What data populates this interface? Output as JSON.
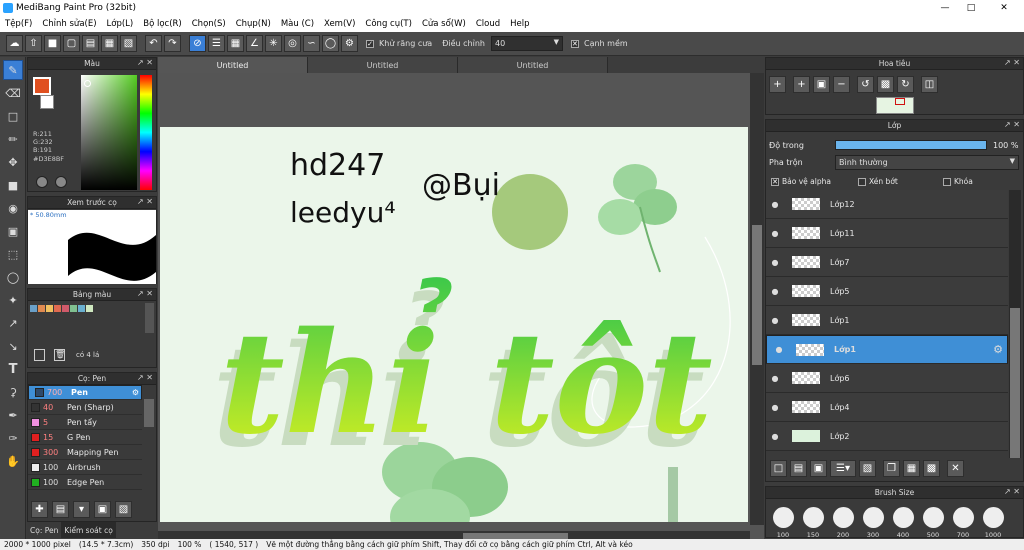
{
  "app": {
    "title": "MediBang Paint Pro (32bit)"
  },
  "menu": [
    "Tệp(F)",
    "Chỉnh sửa(E)",
    "Lớp(L)",
    "Bộ lọc(R)",
    "Chọn(S)",
    "Chụp(N)",
    "Màu (C)",
    "Xem(V)",
    "Công cụ(T)",
    "Cửa sổ(W)",
    "Cloud",
    "Help"
  ],
  "toolbar": {
    "antialias_label": "Khử răng cưa",
    "adjust_label": "Điều chỉnh",
    "adjust_value": "40",
    "soft_edge_label": "Cạnh mềm"
  },
  "color_panel": {
    "title": "Màu",
    "r": "R:211",
    "g": "G:232",
    "b": "B:191",
    "hex": "#D3E8BF",
    "fg_color": "#e05020",
    "bg_color": "#ffffff"
  },
  "brush_preview": {
    "title": "Xem trước cọ",
    "size": "50.80mm"
  },
  "palette": {
    "title": "Bảng màu",
    "count_label": "có 4 lá",
    "swatches": [
      "#6aa0c8",
      "#e08a50",
      "#f0c060",
      "#e06a50",
      "#d05a6a",
      "#80c090",
      "#6ab0d0",
      "#cfe8c0"
    ]
  },
  "brush_panel": {
    "title": "Cọ: Pen",
    "items": [
      {
        "size": "700",
        "name": "Pen",
        "color": "#2e4a6a",
        "selected": true
      },
      {
        "size": "40",
        "name": "Pen (Sharp)",
        "color": "#333333",
        "selected": false
      },
      {
        "size": "5",
        "name": "Pen tẩy",
        "color": "#f090e0",
        "selected": false
      },
      {
        "size": "15",
        "name": "G Pen",
        "color": "#e02020",
        "selected": false
      },
      {
        "size": "300",
        "name": "Mapping Pen",
        "color": "#e02020",
        "selected": false
      },
      {
        "size": "100",
        "name": "Airbrush",
        "color": "#eeeeee",
        "selected": false
      },
      {
        "size": "100",
        "name": "Edge Pen",
        "color": "#20b020",
        "selected": false
      }
    ]
  },
  "bottom_tabs": {
    "tab1": "Cọ: Pen",
    "tab2": "Kiểm soát cọ"
  },
  "doc_tabs": [
    "Untitled",
    "Untitled",
    "Untitled"
  ],
  "artwork": {
    "line1": "hd247",
    "line2": "leedyu⁴",
    "signature": "@Bụi",
    "word1": "thỉ",
    "word2": "tôt"
  },
  "navigator": {
    "title": "Hoa tiêu"
  },
  "layer_panel": {
    "title": "Lớp",
    "opacity_label": "Độ trong",
    "opacity_value": "100 %",
    "opacity": 100,
    "blend_label": "Pha trộn",
    "blend_value": "Bình thường",
    "protect_alpha": "Bảo vệ alpha",
    "clipping": "Xén bớt",
    "lock": "Khóa",
    "layers": [
      {
        "name": "Lớp12",
        "selected": false
      },
      {
        "name": "Lớp11",
        "selected": false
      },
      {
        "name": "Lớp7",
        "selected": false
      },
      {
        "name": "Lớp5",
        "selected": false
      },
      {
        "name": "Lớp1",
        "selected": false
      },
      {
        "name": "Lớp1",
        "selected": true
      },
      {
        "name": "Lớp6",
        "selected": false
      },
      {
        "name": "Lớp4",
        "selected": false
      },
      {
        "name": "Lớp2",
        "selected": false
      }
    ]
  },
  "brush_size": {
    "title": "Brush Size",
    "sizes": [
      "100",
      "150",
      "200",
      "300",
      "400",
      "500",
      "700",
      "1000"
    ]
  },
  "status": {
    "size": "2000 * 1000 pixel",
    "cm": "(14.5 * 7.3cm)",
    "dpi": "350 dpi",
    "zoom": "100 %",
    "coords": "( 1540, 517 )",
    "hint": "Vẽ một đường thẳng bằng cách giữ phím Shift, Thay đổi cỡ cọ bằng cách giữ phím Ctrl, Alt và kéo"
  }
}
